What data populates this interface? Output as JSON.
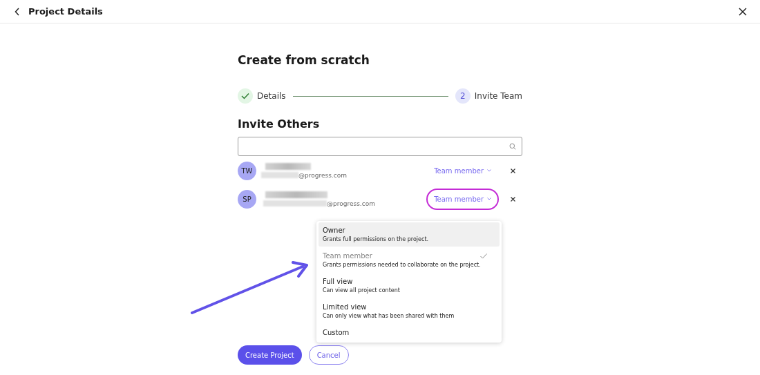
{
  "header": {
    "title": "Project Details"
  },
  "heading": "Create from scratch",
  "steps": [
    {
      "label": "Details",
      "done": true
    },
    {
      "label": "Invite Team",
      "done": false,
      "number": "2"
    }
  ],
  "section_title": "Invite Others",
  "members": [
    {
      "initials": "TW",
      "email": "@progress.com",
      "role": "Team member",
      "highlighted": false
    },
    {
      "initials": "SP",
      "email": "@progress.com",
      "role": "Team member",
      "highlighted": true
    }
  ],
  "role_menu": [
    {
      "label": "Owner",
      "description": "Grants full permissions on the project.",
      "selected": false,
      "hovered": true
    },
    {
      "label": "Team member",
      "description": "Grants permissions needed to collaborate on the project.",
      "selected": true,
      "hovered": false
    },
    {
      "label": "Full view",
      "description": "Can view all project content",
      "selected": false,
      "hovered": false
    },
    {
      "label": "Limited view",
      "description": "Can only view what has been shared with them",
      "selected": false,
      "hovered": false
    },
    {
      "label": "Custom",
      "selected": false,
      "hovered": false
    }
  ],
  "buttons": [
    {
      "label": "Create Project",
      "kind": "primary"
    },
    {
      "label": "Cancel",
      "kind": "secondary"
    }
  ]
}
